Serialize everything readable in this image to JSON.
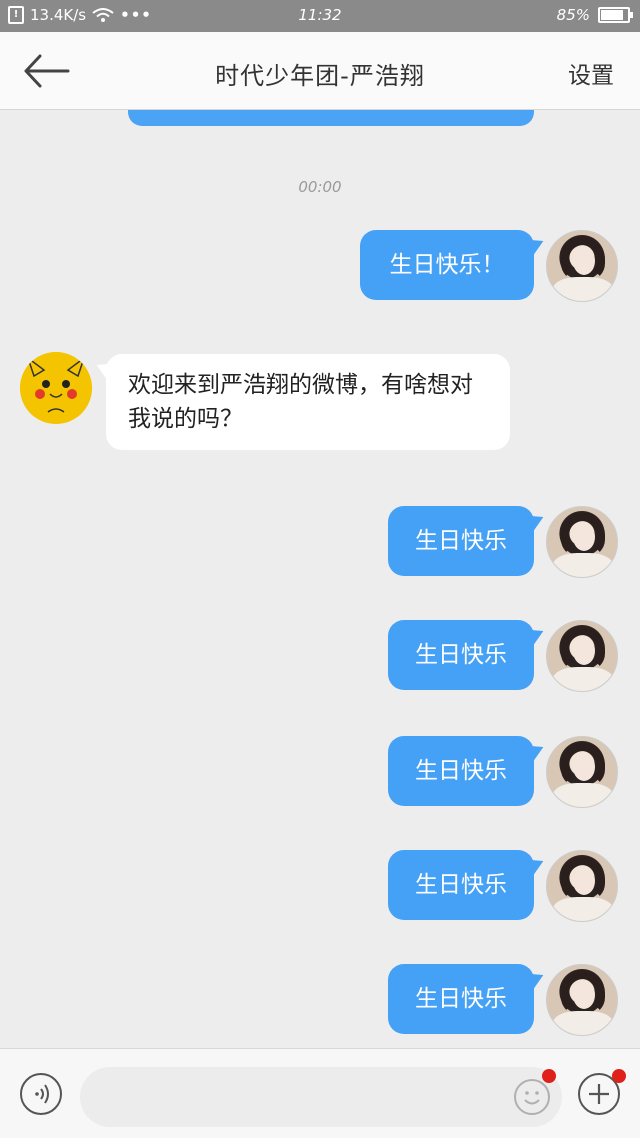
{
  "status_bar": {
    "sim_label": "!",
    "network_speed": "13.4K/s",
    "dots": "•••",
    "time": "11:32",
    "battery_percent": "85%",
    "battery_level": 0.85
  },
  "header": {
    "back_icon": "arrow-left-icon",
    "title": "时代少年团-严浩翔",
    "settings_label": "设置"
  },
  "chat": {
    "timestamp": "00:00",
    "messages": [
      {
        "sender": "me",
        "text": "生日快乐！"
      },
      {
        "sender": "bot",
        "text": "欢迎来到严浩翔的微博，有啥想对我说的吗？"
      },
      {
        "sender": "me",
        "text": "生日快乐"
      },
      {
        "sender": "me",
        "text": "生日快乐"
      },
      {
        "sender": "me",
        "text": "生日快乐"
      },
      {
        "sender": "me",
        "text": "生日快乐"
      },
      {
        "sender": "me",
        "text": "生日快乐"
      }
    ]
  },
  "composer": {
    "voice_icon": "voice-icon",
    "input_value": "",
    "emoji_icon": "emoji-icon",
    "plus_icon": "plus-icon"
  },
  "colors": {
    "accent": "#45a1f6",
    "notification": "#e0201a",
    "bot_avatar": "#f5c400"
  }
}
